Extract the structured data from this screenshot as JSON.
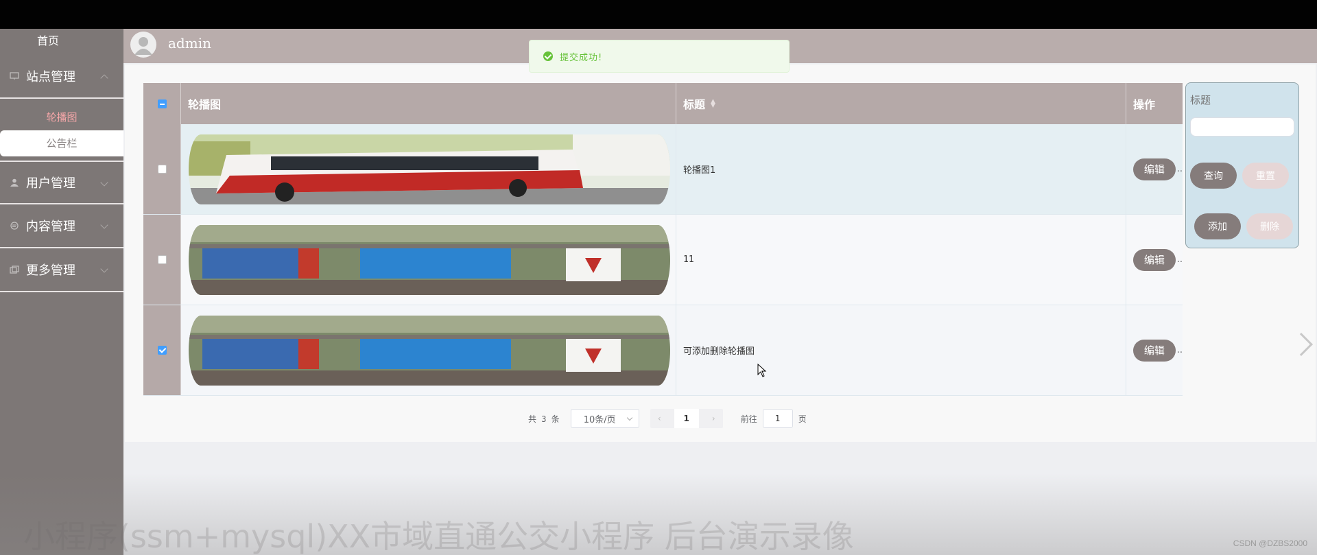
{
  "sidebar": {
    "home": "首页",
    "menus": [
      {
        "label": "站点管理",
        "expanded": true,
        "subitems": [
          "轮播图",
          "公告栏"
        ]
      },
      {
        "label": "用户管理",
        "expanded": false
      },
      {
        "label": "内容管理",
        "expanded": false
      },
      {
        "label": "更多管理",
        "expanded": false
      }
    ]
  },
  "header": {
    "username": "admin"
  },
  "toast": {
    "message": "提交成功!",
    "type": "success"
  },
  "table": {
    "columns": [
      "轮播图",
      "标题",
      "操作"
    ],
    "rows": [
      {
        "image": "bus-photo",
        "title": "轮播图1",
        "checked": false,
        "action": "编辑"
      },
      {
        "image": "bus-stop-billboard-photo",
        "title": "11",
        "checked": false,
        "action": "编辑"
      },
      {
        "image": "bus-stop-billboard-photo",
        "title": "可添加删除轮播图",
        "checked": true,
        "action": "编辑"
      }
    ]
  },
  "search_panel": {
    "label": "标题",
    "input_value": "",
    "buttons": {
      "query": "查询",
      "reset": "重置",
      "add": "添加",
      "delete": "删除"
    }
  },
  "pagination": {
    "total_prefix": "共",
    "total": "3",
    "total_suffix": "条",
    "page_size": "10条/页",
    "current_page": "1",
    "goto_prefix": "前往",
    "goto_value": "1",
    "goto_suffix": "页"
  },
  "overlay_caption": "小程序(ssm+mysql)XX市域直通公交小程序 后台演示录像",
  "credit": "CSDN @DZBS2000",
  "colors": {
    "sidebar": "#7d7776",
    "header": "#b9adac",
    "table_header": "#b5a9a8",
    "active_sub": "#f6a7a9",
    "button": "#857c7b",
    "panel": "#d0e3ec",
    "success": "#67c23a"
  }
}
